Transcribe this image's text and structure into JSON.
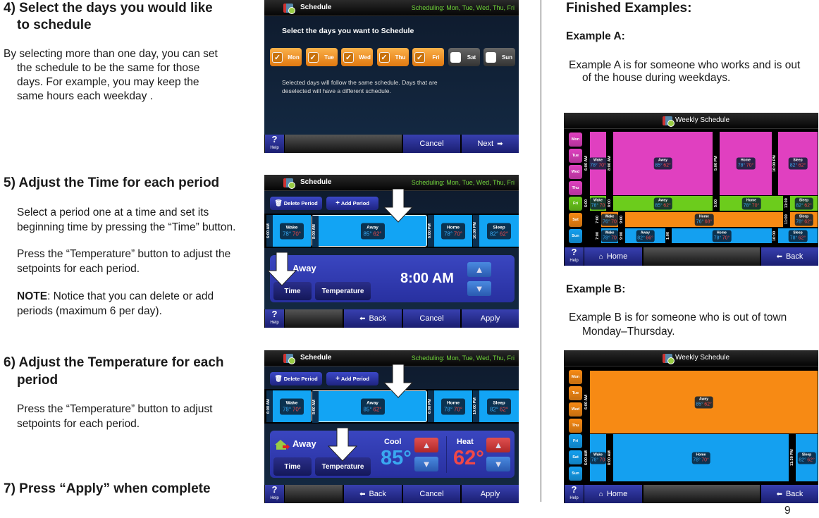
{
  "left": {
    "step4": {
      "heading_line1": "4) Select the days you would like",
      "heading_line2": "to schedule",
      "body": [
        "By selecting more than one day, you can set",
        "the schedule to be the same for those",
        "days. For example, you may keep the",
        "same hours each weekday ."
      ]
    },
    "step5": {
      "heading": "5) Adjust the Time for each period",
      "body1": [
        "Select a period one at a time and set its",
        "beginning time by pressing the “Time” button."
      ],
      "body2": [
        "Press the “Temperature” button to adjust the",
        "setpoints for each period."
      ],
      "note_label": "NOTE",
      "note_text": ": Notice that you can delete or add",
      "note_line2": "periods (maximum 6 per day)."
    },
    "step6": {
      "heading_line1": "6) Adjust the Temperature for each",
      "heading_line2": "period",
      "body": [
        "Press the “Temperature” button to adjust",
        "setpoints for each period."
      ]
    },
    "step7": {
      "heading": "7) Press “Apply” when complete"
    }
  },
  "right": {
    "heading": "Finished Examples:",
    "exA": {
      "title": "Example A:",
      "body": [
        "Example A is for someone who works and is out",
        "of the house during weekdays."
      ]
    },
    "exB": {
      "title": "Example B:",
      "body": [
        "Example B is for someone who is out of town",
        "Monday–Thursday."
      ]
    }
  },
  "page_number": "9",
  "colors": {
    "orange": "#f78a14",
    "magenta": "#e040c0",
    "green": "#6ccc1c",
    "blue": "#14a0f0",
    "cool": "#3aa8f0",
    "heat": "#f04848",
    "scheduling_text": "#6fd23a"
  },
  "screen_common": {
    "title": "Schedule",
    "scheduling": "Scheduling: Mon, Tue, Wed, Thu, Fri",
    "help": "?",
    "help_label": "Help",
    "cancel": "Cancel",
    "next": "Next",
    "back": "Back",
    "apply": "Apply",
    "home": "Home",
    "delete_period": "Delete Period",
    "add_period": "Add Period",
    "time": "Time",
    "temperature": "Temperature",
    "weekly_title": "Weekly Schedule",
    "icons": {
      "schedule": "schedule-calendar-icon",
      "help": "help-icon",
      "next": "arrow-right-icon",
      "back": "arrow-left-icon",
      "home": "home-icon",
      "delete": "trash-icon",
      "add": "plus-icon",
      "house": "away-house-icon"
    }
  },
  "screen1": {
    "prompt": "Select the days you want to Schedule",
    "days": [
      {
        "label": "Mon",
        "checked": true
      },
      {
        "label": "Tue",
        "checked": true
      },
      {
        "label": "Wed",
        "checked": true
      },
      {
        "label": "Thu",
        "checked": true
      },
      {
        "label": "Fri",
        "checked": true
      },
      {
        "label": "Sat",
        "checked": false
      },
      {
        "label": "Sun",
        "checked": false
      }
    ],
    "note_line1": "Selected days will follow the same schedule. Days that are",
    "note_line2": "deselected will have a different schedule."
  },
  "periods": [
    {
      "time": "6:00 AM",
      "name": "Wake",
      "cool": "78°",
      "heat": "70°"
    },
    {
      "time": "8:00 AM",
      "name": "Away",
      "cool": "85°",
      "heat": "62°",
      "selected": true
    },
    {
      "time": "6:00 PM",
      "name": "Home",
      "cool": "78°",
      "heat": "70°"
    },
    {
      "time": "10:00 PM",
      "name": "Sleep",
      "cool": "82°",
      "heat": "62°"
    }
  ],
  "screen2": {
    "period_name": "Away",
    "time_value": "8:00 AM"
  },
  "screen3": {
    "period_name": "Away",
    "cool_label": "Cool",
    "cool_value": "85°",
    "heat_label": "Heat",
    "heat_value": "62°"
  },
  "exampleA": {
    "rows": [
      {
        "days": [
          "Mon",
          "Tue",
          "Wed",
          "Thu"
        ],
        "color": "magenta",
        "periods": [
          {
            "time": "6:00 AM",
            "name": "Wake",
            "cool": "78°",
            "heat": "70°"
          },
          {
            "time": "8:00 AM",
            "name": "Away",
            "cool": "85°",
            "heat": "62°"
          },
          {
            "time": "5:00 PM",
            "name": "Home",
            "cool": "78°",
            "heat": "70°"
          },
          {
            "time": "10:00 PM",
            "name": "Sleep",
            "cool": "82°",
            "heat": "62°"
          }
        ]
      },
      {
        "days": [
          "Fri"
        ],
        "color": "green",
        "periods": [
          {
            "time": "6:00",
            "name": "Wake",
            "cool": "78°",
            "heat": "70"
          },
          {
            "time": "8:00",
            "name": "Away",
            "cool": "85°",
            "heat": "62°"
          },
          {
            "time": "5:00",
            "name": "Home",
            "cool": "78°",
            "heat": "70°"
          },
          {
            "time": "11:00",
            "name": "Sleep",
            "cool": "82°",
            "heat": "62°"
          }
        ]
      },
      {
        "days": [
          "Sat"
        ],
        "color": "orange",
        "periods": [
          {
            "time": "7:00",
            "name": "Wake",
            "cool": "76°",
            "heat": "70"
          },
          {
            "time": "9:00",
            "name": "Home",
            "cool": "76°",
            "heat": "68°"
          },
          {
            "time": "11:00",
            "name": "Sleep",
            "cool": "78°",
            "heat": "62°"
          }
        ]
      },
      {
        "days": [
          "Sun"
        ],
        "color": "blue",
        "periods": [
          {
            "time": "7:00",
            "name": "Wake",
            "cool": "78°",
            "heat": "70"
          },
          {
            "time": "9:00",
            "name": "Away",
            "cool": "82°",
            "heat": "66°"
          },
          {
            "time": "1:00",
            "name": "Home",
            "cool": "78°",
            "heat": "70°"
          },
          {
            "time": "10:00",
            "name": "Sleep",
            "cool": "78°",
            "heat": "62°"
          }
        ]
      }
    ]
  },
  "exampleB": {
    "rows": [
      {
        "days": [
          "Mon",
          "Tue",
          "Wed",
          "Thu"
        ],
        "color": "orange",
        "periods": [
          {
            "time": "6:00 AM",
            "name": "Away",
            "cool": "85°",
            "heat": "62°"
          }
        ]
      },
      {
        "days": [
          "Fri",
          "Sat",
          "Sun"
        ],
        "color": "blue",
        "periods": [
          {
            "time": "6:00 AM",
            "name": "Wake",
            "cool": "78°",
            "heat": "70"
          },
          {
            "time": "8:00 AM",
            "name": "Home",
            "cool": "78°",
            "heat": "70°"
          },
          {
            "time": "11:30 PM",
            "name": "Sleep",
            "cool": "82°",
            "heat": "62°"
          }
        ]
      }
    ]
  }
}
